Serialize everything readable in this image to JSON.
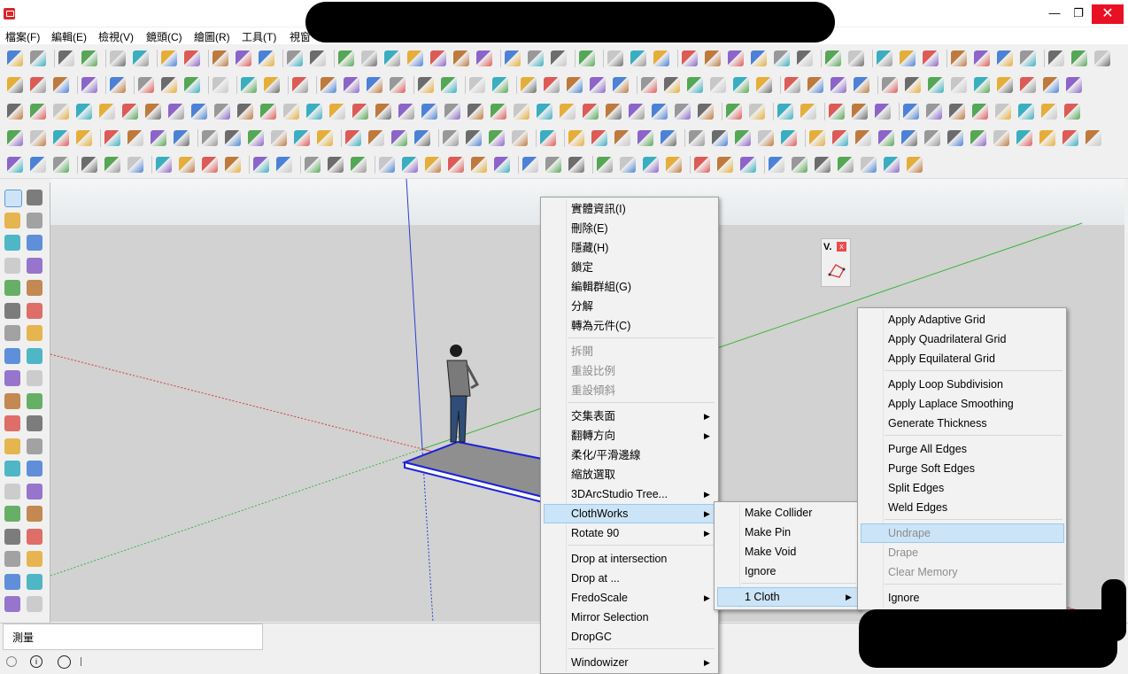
{
  "window": {
    "minimize": "—",
    "restore": "❐",
    "close": "✕"
  },
  "menubar": {
    "items": [
      "檔案(F)",
      "編輯(E)",
      "檢視(V)",
      "鏡頭(C)",
      "繪圖(R)",
      "工具(T)",
      "視窗"
    ]
  },
  "status": {
    "measure_label": "測量"
  },
  "floating_panel": {
    "title": "V.",
    "close": "x"
  },
  "context_menu": {
    "items": [
      {
        "label": "實體資訊(I)",
        "enabled": true
      },
      {
        "label": "刪除(E)",
        "enabled": true
      },
      {
        "label": "隱藏(H)",
        "enabled": true
      },
      {
        "label": "鎖定",
        "enabled": true
      },
      {
        "label": "編輯群組(G)",
        "enabled": true
      },
      {
        "label": "分解",
        "enabled": true
      },
      {
        "label": "轉為元件(C)",
        "enabled": true
      },
      {
        "label": "拆開",
        "enabled": false
      },
      {
        "label": "重設比例",
        "enabled": false
      },
      {
        "label": "重設傾斜",
        "enabled": false
      },
      {
        "label": "交集表面",
        "enabled": true,
        "submenu": true
      },
      {
        "label": "翻轉方向",
        "enabled": true,
        "submenu": true
      },
      {
        "label": "柔化/平滑邊線",
        "enabled": true
      },
      {
        "label": "縮放選取",
        "enabled": true
      },
      {
        "label": "3DArcStudio Tree...",
        "enabled": true,
        "submenu": true
      },
      {
        "label": "ClothWorks",
        "enabled": true,
        "submenu": true,
        "highlighted": true
      },
      {
        "label": "Rotate 90",
        "enabled": true,
        "submenu": true
      },
      {
        "label": "Drop at intersection",
        "enabled": true
      },
      {
        "label": "Drop at ...",
        "enabled": true
      },
      {
        "label": "FredoScale",
        "enabled": true,
        "submenu": true
      },
      {
        "label": "Mirror Selection",
        "enabled": true
      },
      {
        "label": "DropGC",
        "enabled": true
      },
      {
        "label": "Windowizer",
        "enabled": true,
        "submenu": true
      }
    ]
  },
  "clothworks_menu": {
    "items": [
      {
        "label": "Make Collider"
      },
      {
        "label": "Make Pin"
      },
      {
        "label": "Make Void"
      },
      {
        "label": "Ignore"
      },
      {
        "label": "1 Cloth",
        "submenu": true,
        "highlighted": true
      }
    ]
  },
  "cloth_menu": {
    "items": [
      {
        "label": "Apply Adaptive Grid",
        "enabled": true
      },
      {
        "label": "Apply Quadrilateral Grid",
        "enabled": true
      },
      {
        "label": "Apply Equilateral Grid",
        "enabled": true
      },
      {
        "label": "Apply Loop Subdivision",
        "enabled": true
      },
      {
        "label": "Apply Laplace Smoothing",
        "enabled": true
      },
      {
        "label": "Generate Thickness",
        "enabled": true
      },
      {
        "label": "Purge All Edges",
        "enabled": true
      },
      {
        "label": "Purge Soft Edges",
        "enabled": true
      },
      {
        "label": "Split Edges",
        "enabled": true
      },
      {
        "label": "Weld Edges",
        "enabled": true
      },
      {
        "label": "Undrape",
        "enabled": false,
        "highlighted": true
      },
      {
        "label": "Drape",
        "enabled": false
      },
      {
        "label": "Clear Memory",
        "enabled": false
      },
      {
        "label": "Ignore",
        "enabled": true
      }
    ]
  },
  "colors": {
    "axis_red": "#d83a3a",
    "axis_green": "#3cb43c",
    "axis_blue": "#2a3fd0",
    "menu_highlight": "#cce4f7",
    "close_button": "#e81123"
  }
}
